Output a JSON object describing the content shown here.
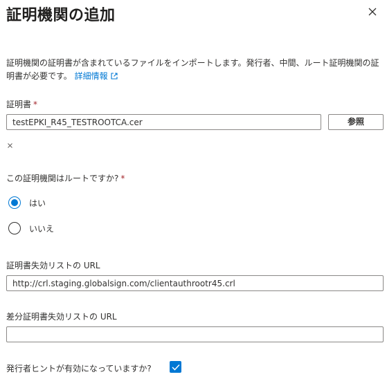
{
  "panel": {
    "title": "証明機関の追加",
    "close_icon": "close-icon"
  },
  "description": {
    "text": "証明機関の証明書が含まれているファイルをインポートします。発行者、中間、ルート証明機関の証明書が必要です。",
    "link_label": "詳細情報",
    "link_icon": "external-link-icon"
  },
  "certificate": {
    "label": "証明書",
    "required_mark": "*",
    "value": "testEPKI_R45_TESTROOTCA.cer",
    "browse_label": "参照",
    "clear_icon": "clear-icon"
  },
  "root_question": {
    "label": "この証明機関はルートですか?",
    "required_mark": "*",
    "options": [
      "はい",
      "いいえ"
    ],
    "selected": "はい"
  },
  "crl": {
    "label": "証明書失効リストの URL",
    "value": "http://crl.staging.globalsign.com/clientauthrootr45.crl"
  },
  "delta_crl": {
    "label": "差分証明書失効リストの URL",
    "value": ""
  },
  "issuer_hints": {
    "label": "発行者ヒントが有効になっていますか?",
    "checked": true
  },
  "colors": {
    "accent": "#0078d4",
    "required": "#a4262c",
    "text": "#323130",
    "border": "#8a8886"
  }
}
